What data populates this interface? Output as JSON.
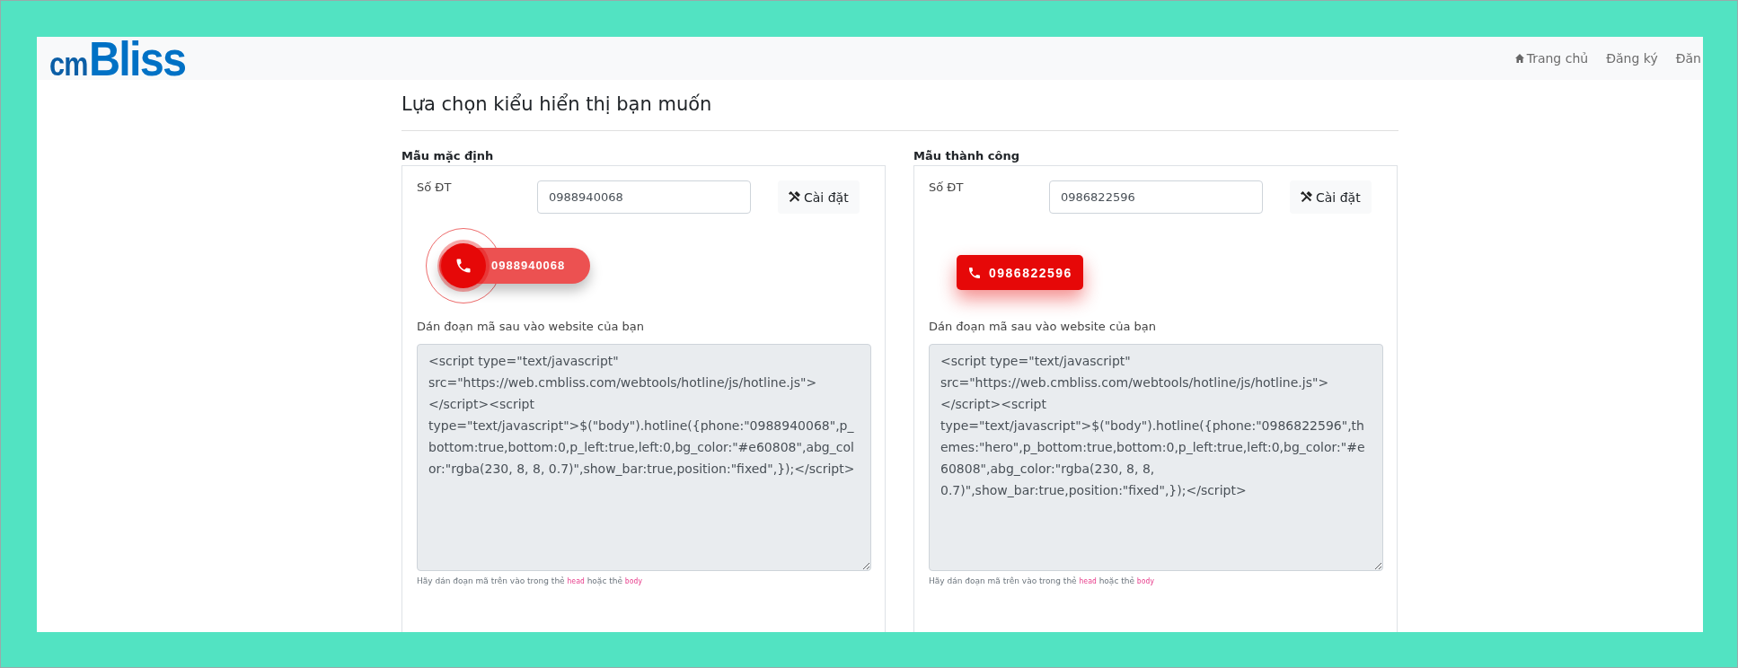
{
  "logo": {
    "part1": "cm",
    "part2": "Bliss"
  },
  "nav": [
    {
      "label": "Trang chủ",
      "kind": "home"
    },
    {
      "label": "Đăng ký",
      "kind": "text"
    },
    {
      "label": "Đăn",
      "kind": "text"
    }
  ],
  "title": "Lựa chọn kiểu hiển thị bạn muốn",
  "cards": [
    {
      "heading": "Mẫu mặc định",
      "field_label": "Số ĐT",
      "phone": "0988940068",
      "settings_button": "Cài đặt",
      "widget": {
        "kind": "pulse",
        "number": "0988940068"
      },
      "code_label": "Dán đoạn mã sau vào website của bạn",
      "code": "<script type=\"text/javascript\" src=\"https://web.cmbliss.com/webtools/hotline/js/hotline.js\"></script><script type=\"text/javascript\">$(\"body\").hotline({phone:\"0988940068\",p_bottom:true,bottom:0,p_left:true,left:0,bg_color:\"#e60808\",abg_color:\"rgba(230, 8, 8, 0.7)\",show_bar:true,position:\"fixed\",});</script>",
      "hint": [
        {
          "text": "Hãy dán đoạn mã trên vào trong thẻ",
          "code": false
        },
        {
          "text": "head",
          "code": true
        },
        {
          "text": "hoặc thẻ",
          "code": false
        },
        {
          "text": "body",
          "code": true
        }
      ]
    },
    {
      "heading": "Mẫu thành công",
      "field_label": "Số ĐT",
      "phone": "0986822596",
      "settings_button": "Cài đặt",
      "widget": {
        "kind": "hero",
        "number": "0986822596"
      },
      "code_label": "Dán đoạn mã sau vào website của bạn",
      "code": "<script type=\"text/javascript\" src=\"https://web.cmbliss.com/webtools/hotline/js/hotline.js\"></script><script type=\"text/javascript\">$(\"body\").hotline({phone:\"0986822596\",themes:\"hero\",p_bottom:true,bottom:0,p_left:true,left:0,bg_color:\"#e60808\",abg_color:\"rgba(230, 8, 8, 0.7)\",show_bar:true,position:\"fixed\",});</script>",
      "hint": [
        {
          "text": "Hãy dán đoạn mã trên vào trong thẻ",
          "code": false
        },
        {
          "text": "head",
          "code": true
        },
        {
          "text": "hoặc thẻ",
          "code": false
        },
        {
          "text": "body",
          "code": true
        }
      ]
    }
  ]
}
